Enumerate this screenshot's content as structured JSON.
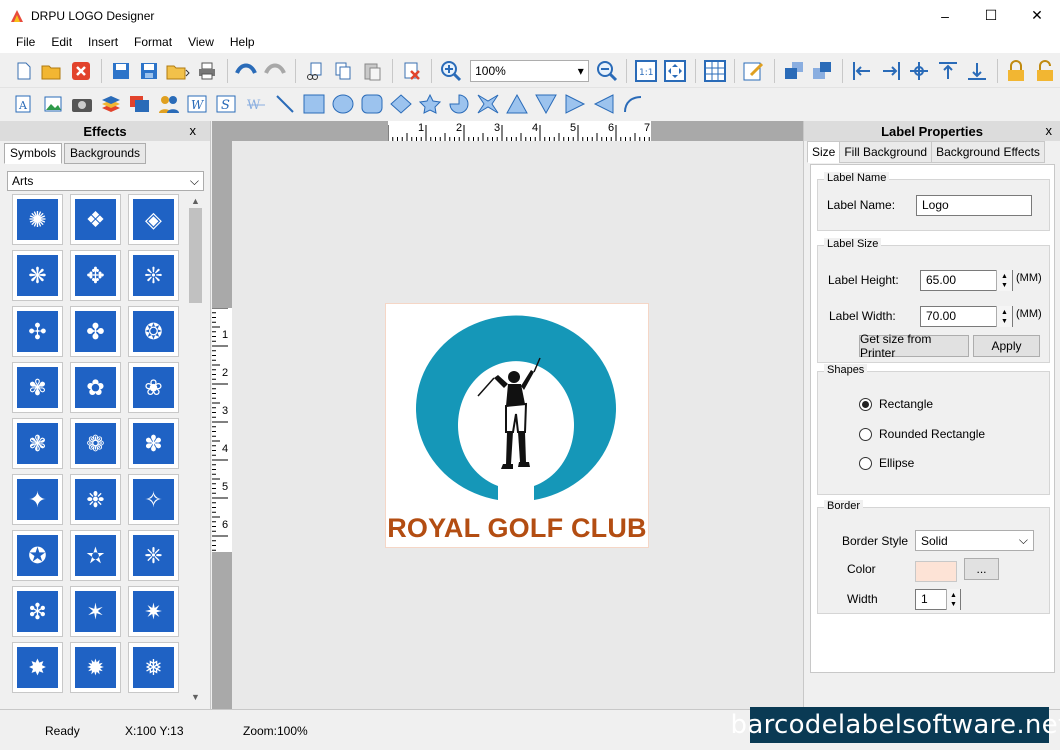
{
  "window": {
    "title": "DRPU LOGO Designer",
    "minimize": "–",
    "maximize": "☐",
    "close": "✕"
  },
  "menu": [
    "File",
    "Edit",
    "Insert",
    "Format",
    "View",
    "Help"
  ],
  "toolbar": {
    "zoom_value": "100%",
    "zoom_arrow": "▾"
  },
  "effects": {
    "title": "Effects",
    "close": "x",
    "tabs": [
      "Symbols",
      "Backgrounds"
    ],
    "category": "Arts",
    "category_arrow": "⌵"
  },
  "canvas": {
    "ruler_h": [
      "1",
      "2",
      "3",
      "4",
      "5",
      "6",
      "7"
    ],
    "ruler_v": [
      "1",
      "2",
      "3",
      "4",
      "5",
      "6"
    ],
    "logo_text": "ROYAL GOLF CLUB"
  },
  "props": {
    "title": "Label Properties",
    "close": "x",
    "tabs": [
      "Size",
      "Fill Background",
      "Background Effects"
    ],
    "label_name_group": "Label Name",
    "label_name_caption": "Label Name:",
    "label_name_value": "Logo",
    "label_size_group": "Label Size",
    "height_caption": "Label Height:",
    "height_value": "65.00",
    "width_caption": "Label Width:",
    "width_value": "70.00",
    "unit": "(MM)",
    "get_size_button": "Get size from Printer",
    "apply_button": "Apply",
    "shapes_group": "Shapes",
    "shape_options": [
      "Rectangle",
      "Rounded Rectangle",
      "Ellipse"
    ],
    "selected_shape": "Rectangle",
    "border_group": "Border",
    "border_style_caption": "Border Style",
    "border_style_value": "Solid",
    "color_caption": "Color",
    "color_value": "#fde3d6",
    "color_button": "...",
    "width_caption2": "Width",
    "border_width_value": "1"
  },
  "status": {
    "ready": "Ready",
    "coords": "X:100  Y:13",
    "zoom": "Zoom:100%"
  },
  "watermark": "barcodelabelsoftware.net",
  "colors": {
    "logo_ring": "#1597b8",
    "logo_text": "#b34d12",
    "symbol_tile": "#1f62c4"
  }
}
